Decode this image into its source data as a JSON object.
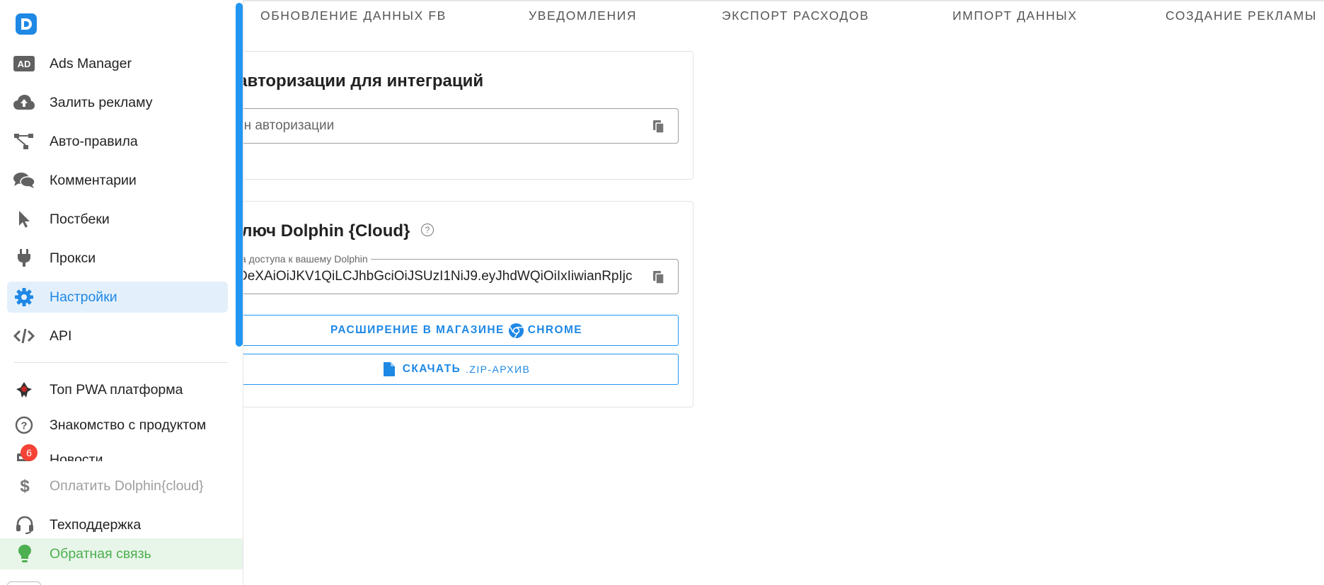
{
  "tabs": [
    {
      "label": "ОБНОВЛЕНИЕ ДАННЫХ FB"
    },
    {
      "label": "УВЕДОМЛЕНИЯ"
    },
    {
      "label": "ЭКСПОРТ РАСХОДОВ"
    },
    {
      "label": "ИМПОРТ ДАННЫХ"
    },
    {
      "label": "СОЗДАНИЕ РЕКЛАМЫ"
    }
  ],
  "auth_card": {
    "title": "н авторизации для интеграций",
    "field_placeholder": "ен авторизации"
  },
  "cloud_card": {
    "title": "ключ Dolphin {Cloud}",
    "field_legend": "а доступа к вашему Dolphin",
    "field_value": "DeXAiOiJKV1QiLCJhbGciOiJSUzI1NiJ9.eyJhdWQiOiIxIiwianRpIjc",
    "chrome_button": {
      "text": "РАСШИРЕНИЕ В МАГАЗИНЕ",
      "brand": "CHROME"
    },
    "zip_button": {
      "text": "СКАЧАТЬ",
      "suffix": ".ZIP-АРХИВ"
    }
  },
  "sidebar": {
    "items": [
      {
        "label": "Ads Manager",
        "icon": "ad-icon"
      },
      {
        "label": "Залить рекламу",
        "icon": "cloud-upload-icon"
      },
      {
        "label": "Авто-правила",
        "icon": "sitemap-icon"
      },
      {
        "label": "Комментарии",
        "icon": "comments-icon"
      },
      {
        "label": "Постбеки",
        "icon": "cursor-icon"
      },
      {
        "label": "Прокси",
        "icon": "plug-icon"
      },
      {
        "label": "Настройки",
        "icon": "gear-icon",
        "active": true
      },
      {
        "label": "API",
        "icon": "code-icon"
      }
    ],
    "extra_items": [
      {
        "label": "Топ PWA платформа",
        "icon": "pwa-logo-icon"
      },
      {
        "label": "Знакомство с продуктом",
        "icon": "question-circle-icon"
      },
      {
        "label": "Новости",
        "icon": "news-icon",
        "badge": "6"
      }
    ],
    "bottom_items": [
      {
        "label": "Оплатить Dolphin{cloud}",
        "icon": "dollar-icon"
      },
      {
        "label": "Техподдержка",
        "icon": "headset-icon"
      },
      {
        "label": "Обратная связь",
        "icon": "lightbulb-icon"
      }
    ]
  },
  "colors": {
    "accent": "#1e88e5",
    "active_bg": "#e3f0fc",
    "feedback_green": "#4caf50",
    "badge_red": "#f44336"
  }
}
